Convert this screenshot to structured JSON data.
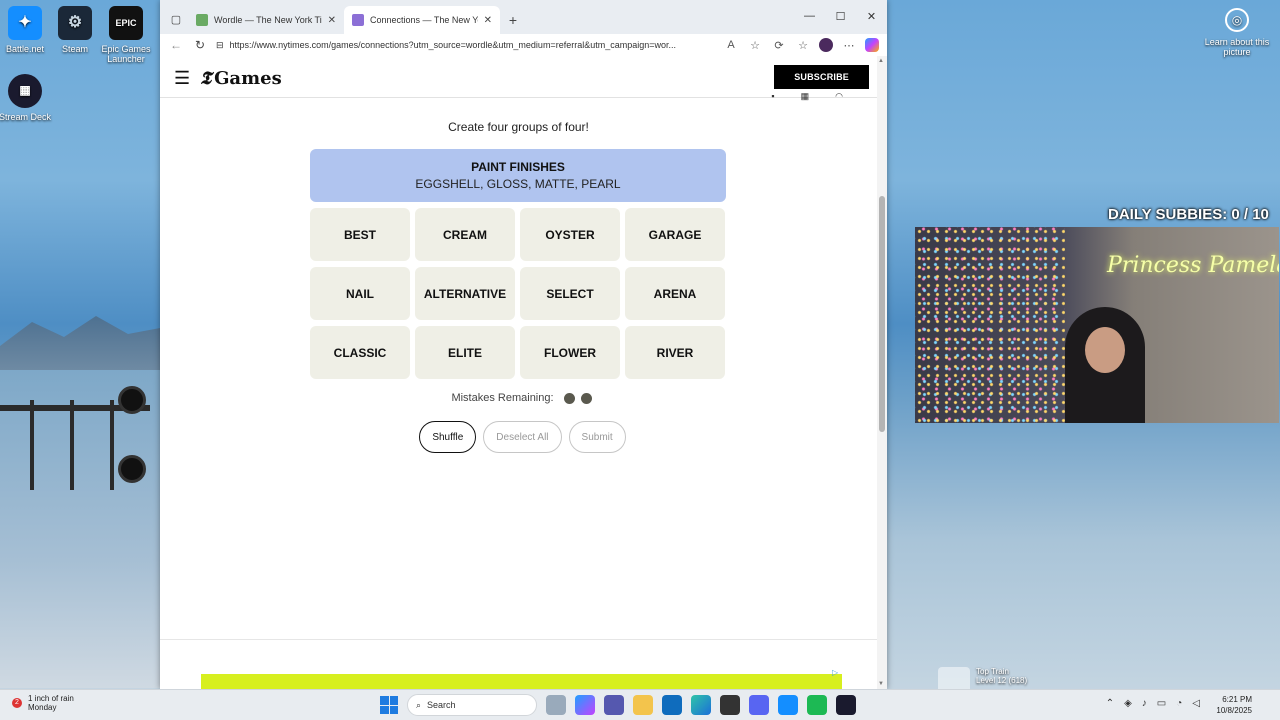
{
  "desktop": {
    "icons": [
      {
        "label": "Battle.net"
      },
      {
        "label": "Steam"
      },
      {
        "label": "Epic Games Launcher"
      },
      {
        "label": "Stream Deck"
      }
    ],
    "learn_label": "Learn about this picture"
  },
  "browser": {
    "tabs": [
      {
        "title": "Wordle — The New York Times",
        "active": false
      },
      {
        "title": "Connections — The New York Tim",
        "active": true
      }
    ],
    "url": "https://www.nytimes.com/games/connections?utm_source=wordle&utm_medium=referral&utm_campaign=wor..."
  },
  "nyt": {
    "logo_text": "Games",
    "subscribe_label": "SUBSCRIBE"
  },
  "game": {
    "subtitle": "Create four groups of four!",
    "solved": [
      {
        "category": "PAINT FINISHES",
        "words": "EGGSHELL, GLOSS, MATTE, PEARL",
        "color": "#b0c4ef"
      }
    ],
    "tiles": [
      "BEST",
      "CREAM",
      "OYSTER",
      "GARAGE",
      "NAIL",
      "ALTERNATIVE",
      "SELECT",
      "ARENA",
      "CLASSIC",
      "ELITE",
      "FLOWER",
      "RIVER"
    ],
    "mistakes_label": "Mistakes Remaining:",
    "mistakes_remaining": 2,
    "buttons": {
      "shuffle": "Shuffle",
      "deselect": "Deselect All",
      "submit": "Submit"
    }
  },
  "overlay": {
    "subbies": "DAILY SUBBIES:  0 / 10",
    "neon_sign": "Princess Pamela",
    "top_train_title": "Top Train",
    "top_train_level": "Level 12 (618)"
  },
  "taskbar": {
    "weather_badge": "2",
    "weather_line1": "1 inch of rain",
    "weather_line2": "Monday",
    "search_label": "Search",
    "time": "6:21 PM",
    "date": "10/8/2025"
  }
}
